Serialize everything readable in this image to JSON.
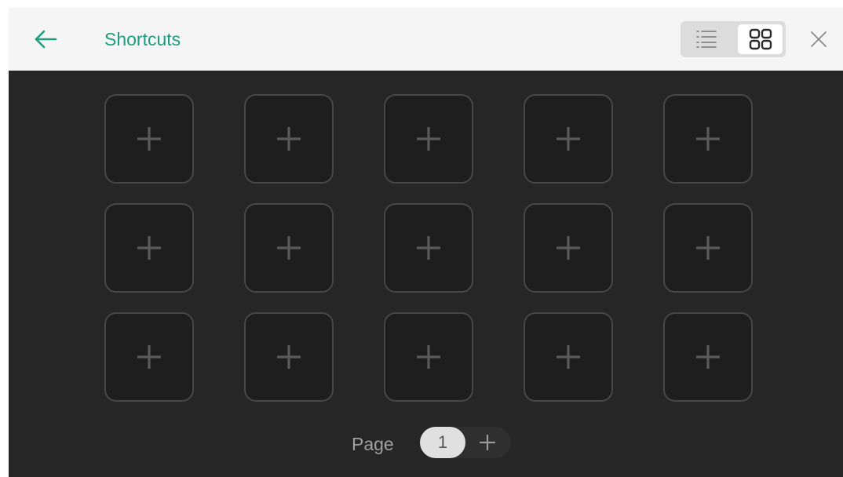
{
  "header": {
    "title": "Shortcuts",
    "back_icon": "arrow-left-icon",
    "close_icon": "close-icon",
    "accent_color": "#1e9e7e",
    "view_toggle": {
      "options": [
        {
          "name": "list-view",
          "icon": "list-icon",
          "selected": false
        },
        {
          "name": "grid-view",
          "icon": "grid-icon",
          "selected": true
        }
      ]
    }
  },
  "grid": {
    "rows": 3,
    "columns": 5,
    "tiles": [
      {
        "icon": "plus-icon"
      },
      {
        "icon": "plus-icon"
      },
      {
        "icon": "plus-icon"
      },
      {
        "icon": "plus-icon"
      },
      {
        "icon": "plus-icon"
      },
      {
        "icon": "plus-icon"
      },
      {
        "icon": "plus-icon"
      },
      {
        "icon": "plus-icon"
      },
      {
        "icon": "plus-icon"
      },
      {
        "icon": "plus-icon"
      },
      {
        "icon": "plus-icon"
      },
      {
        "icon": "plus-icon"
      },
      {
        "icon": "plus-icon"
      },
      {
        "icon": "plus-icon"
      },
      {
        "icon": "plus-icon"
      }
    ]
  },
  "pager": {
    "label": "Page",
    "current_page": "1",
    "add_icon": "plus-icon"
  }
}
